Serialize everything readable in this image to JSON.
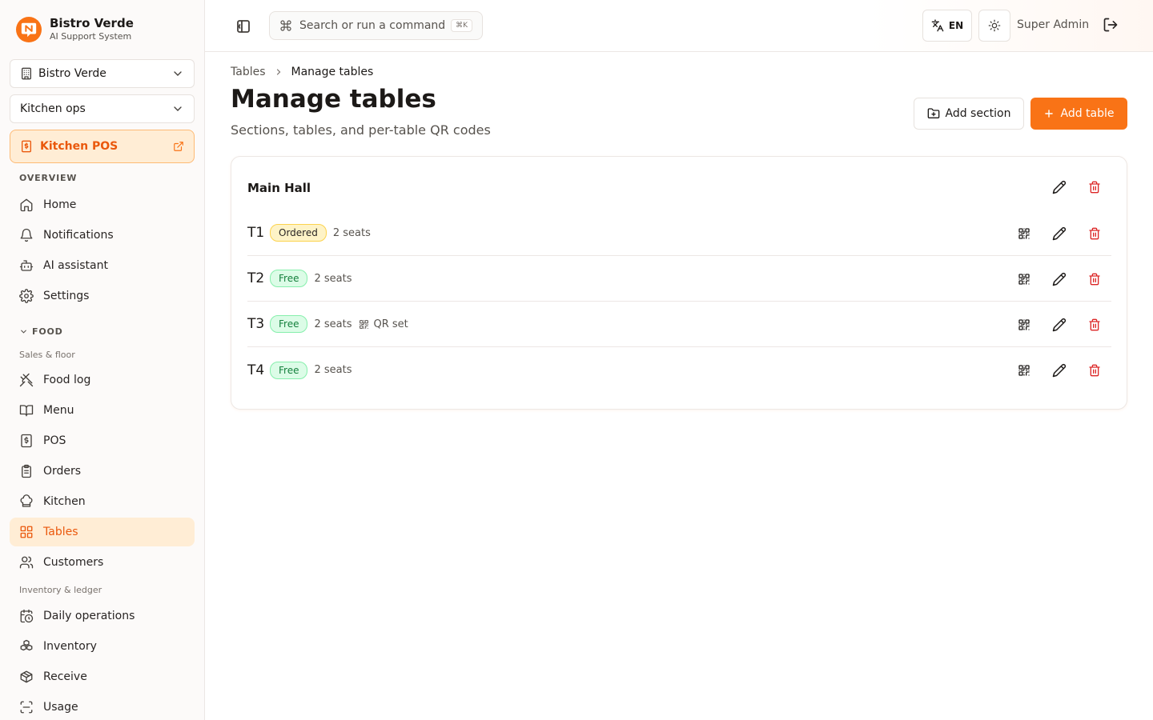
{
  "app": {
    "name": "Bistro Verde",
    "subtitle": "AI Support System"
  },
  "sidebar": {
    "restaurant_select": "Bistro Verde",
    "role_select": "Kitchen ops",
    "pos_card": "Kitchen POS",
    "overview_heading": "OVERVIEW",
    "overview_items": [
      {
        "label": "Home",
        "icon": "home-icon"
      },
      {
        "label": "Notifications",
        "icon": "bell-icon"
      },
      {
        "label": "AI assistant",
        "icon": "bot-icon"
      },
      {
        "label": "Settings",
        "icon": "gear-icon"
      }
    ],
    "food_heading": "FOOD",
    "sales_subheading": "Sales & floor",
    "sales_items": [
      {
        "label": "Food log",
        "icon": "utensils-icon"
      },
      {
        "label": "Menu",
        "icon": "book-icon"
      },
      {
        "label": "POS",
        "icon": "pos-icon"
      },
      {
        "label": "Orders",
        "icon": "clipboard-icon"
      },
      {
        "label": "Kitchen",
        "icon": "chef-hat-icon"
      },
      {
        "label": "Tables",
        "icon": "grid-icon",
        "active": true
      },
      {
        "label": "Customers",
        "icon": "users-icon"
      }
    ],
    "inventory_subheading": "Inventory & ledger",
    "inventory_items": [
      {
        "label": "Daily operations",
        "icon": "calendar-clock-icon"
      },
      {
        "label": "Inventory",
        "icon": "boxes-icon"
      },
      {
        "label": "Receive",
        "icon": "package-icon"
      },
      {
        "label": "Usage",
        "icon": "scan-icon"
      }
    ]
  },
  "header": {
    "search_placeholder": "Search or run a command",
    "search_shortcut": "⌘K",
    "language": "EN",
    "user": "Super Admin"
  },
  "main": {
    "breadcrumb": {
      "parent": "Tables",
      "current": "Manage tables"
    },
    "title": "Manage tables",
    "subtitle": "Sections, tables, and per-table QR codes",
    "add_section_label": "Add section",
    "add_table_label": "Add table",
    "section": {
      "name": "Main Hall",
      "tables": [
        {
          "name": "T1",
          "status": "Ordered",
          "seats": "2 seats",
          "qr": ""
        },
        {
          "name": "T2",
          "status": "Free",
          "seats": "2 seats",
          "qr": ""
        },
        {
          "name": "T3",
          "status": "Free",
          "seats": "2 seats",
          "qr": "QR set"
        },
        {
          "name": "T4",
          "status": "Free",
          "seats": "2 seats",
          "qr": ""
        }
      ]
    }
  },
  "colors": {
    "accent": "#f97316",
    "danger": "#dc2626",
    "free": "#15803d",
    "ordered": "#fef3c7"
  }
}
